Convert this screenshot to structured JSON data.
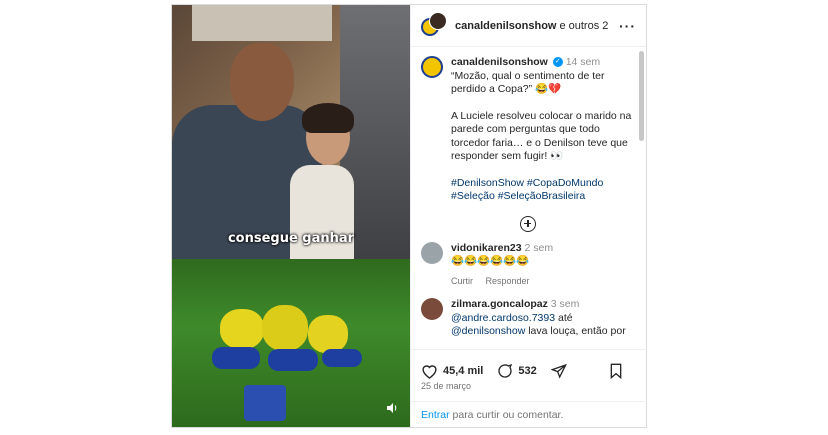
{
  "header": {
    "username": "canaldenilsonshow",
    "collaborators": "e outros 2"
  },
  "media": {
    "subtitle": "consegue ganhar"
  },
  "caption": {
    "username": "canaldenilsonshow",
    "time": "14 sem",
    "line1": "“Mozão, qual o sentimento de ter perdido a Copa?” 😂💔",
    "line2": "A Luciele resolveu colocar o marido na parede com perguntas que todo torcedor faria… e o Denilson teve que responder sem fugir! 👀",
    "hashtags1": "#DenilsonShow #CopaDoMundo",
    "hashtags2": "#Seleção #SeleçãoBrasileira"
  },
  "comments": [
    {
      "username": "vidonikaren23",
      "time": "2 sem",
      "text": "😂😂😂😂😂😂",
      "reply_label": "Responder",
      "like_label": "Curtir"
    },
    {
      "username": "zilmara.goncalopaz",
      "time": "3 sem",
      "mention1": "@andre.cardoso.7393",
      "text1": " até",
      "mention2": "@denilsonshow",
      "text2": " lava louça, então por"
    }
  ],
  "actions": {
    "likes": "45,4 mil",
    "comments": "532"
  },
  "date": "25 de março",
  "add_comment": {
    "login_label": "Entrar",
    "prompt": " para curtir ou comentar."
  },
  "colors": {
    "link": "#0095f6",
    "hashtag": "#00376b",
    "muted": "#8e8e8e"
  }
}
